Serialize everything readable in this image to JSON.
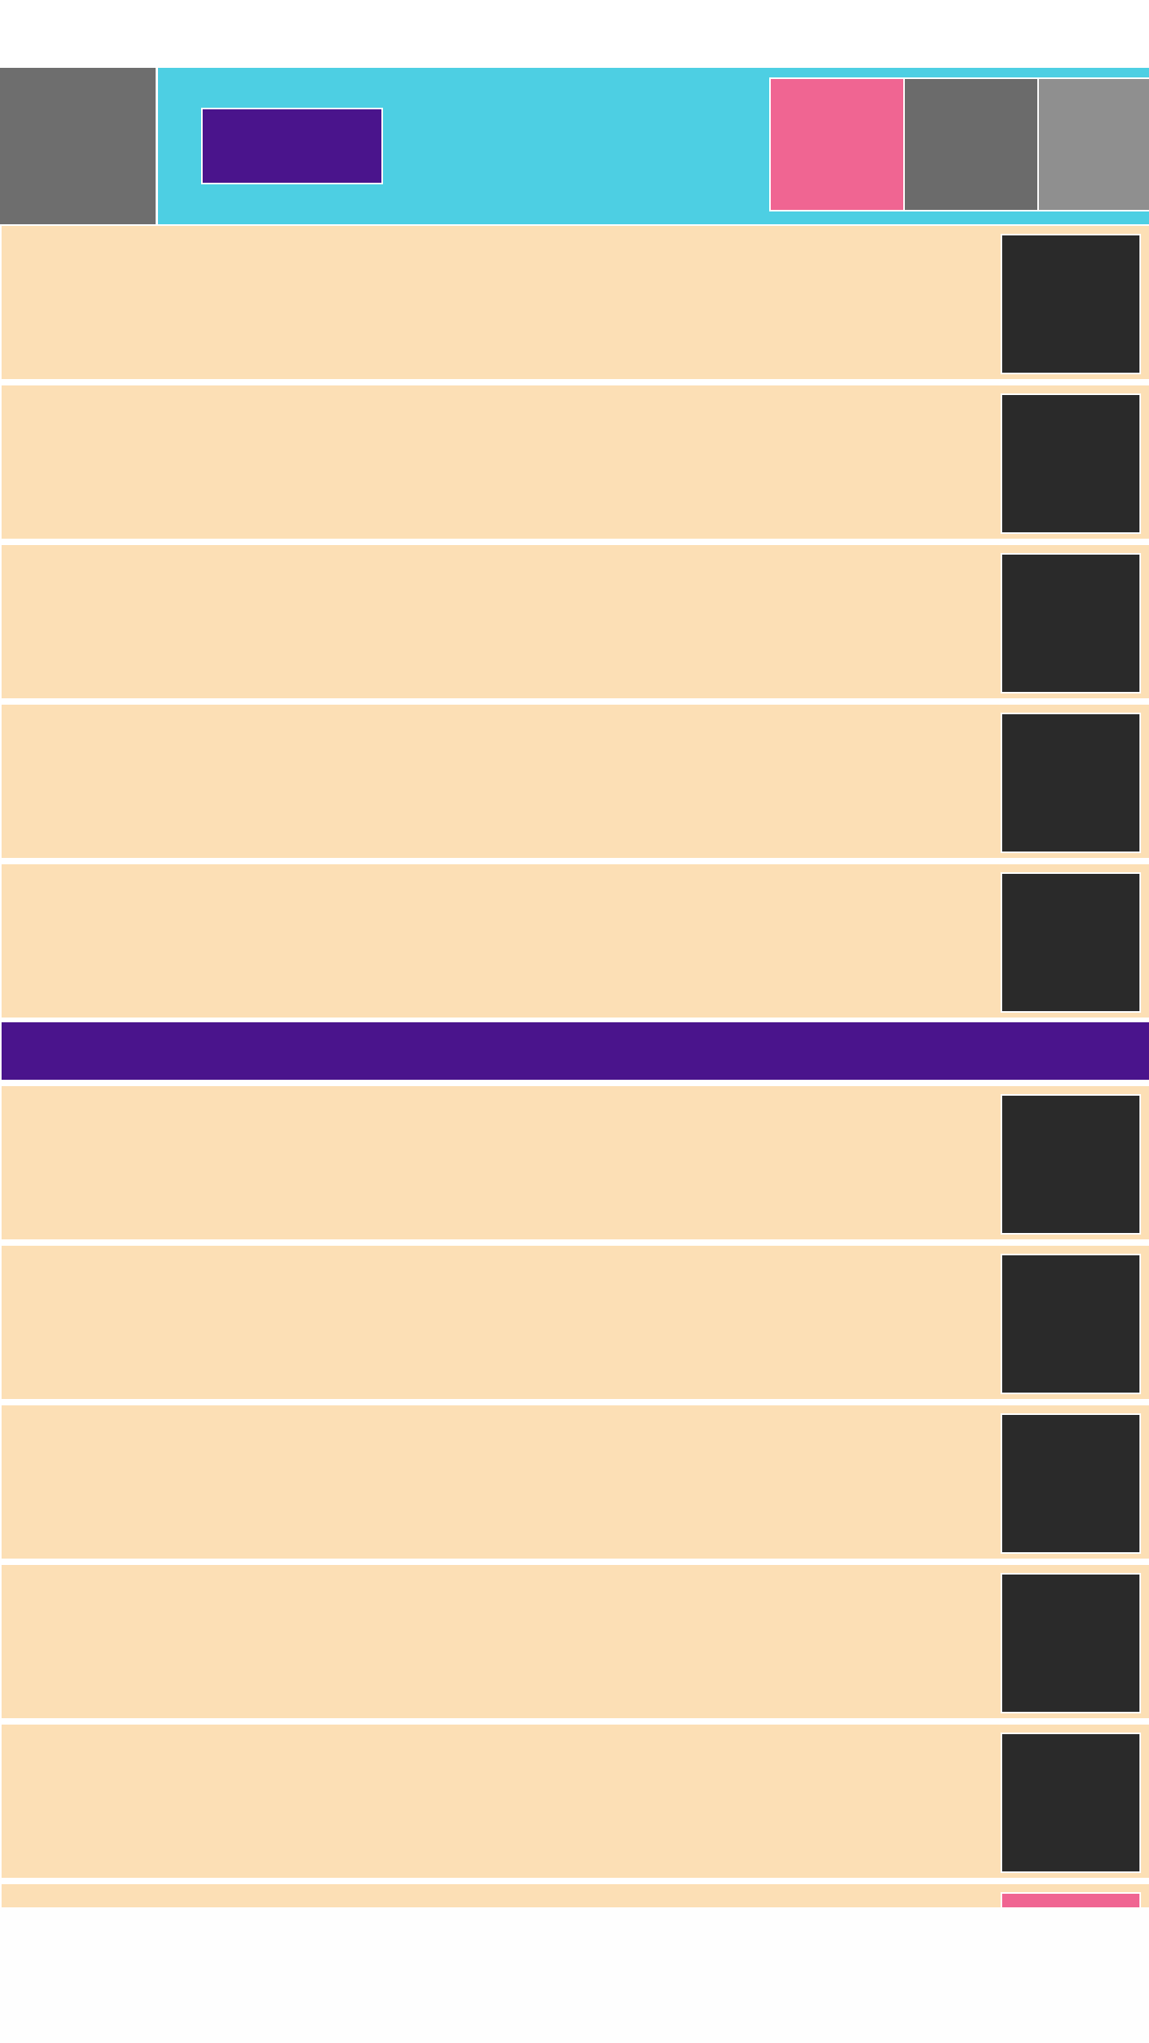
{
  "colors": {
    "header_bg": "#4dcfe3",
    "logo_bg": "#6e6e6e",
    "primary_bg": "#4a148c",
    "pink": "#f06592",
    "gray_dark": "#6b6b6b",
    "gray_light": "#8f8f8f",
    "row_bg": "#fcdfb5",
    "thumb_bg": "#2a2a2a",
    "section_bg": "#4a148c"
  },
  "header": {
    "logo": {
      "icon": "logo-placeholder",
      "label": ""
    },
    "primary_button": {
      "label": ""
    },
    "actions": [
      {
        "label": "",
        "color": "#f06592"
      },
      {
        "label": "",
        "color": "#6b6b6b"
      },
      {
        "label": "",
        "color": "#8f8f8f"
      }
    ]
  },
  "section_divider": {
    "label": ""
  },
  "list_items": [
    {
      "title": "",
      "thumb_icon": "image-placeholder"
    },
    {
      "title": "",
      "thumb_icon": "image-placeholder"
    },
    {
      "title": "",
      "thumb_icon": "image-placeholder"
    },
    {
      "title": "",
      "thumb_icon": "image-placeholder"
    },
    {
      "title": "",
      "thumb_icon": "image-placeholder"
    }
  ],
  "list_items_2": [
    {
      "title": "",
      "thumb_icon": "image-placeholder"
    },
    {
      "title": "",
      "thumb_icon": "image-placeholder"
    },
    {
      "title": "",
      "thumb_icon": "image-placeholder"
    },
    {
      "title": "",
      "thumb_icon": "image-placeholder"
    },
    {
      "title": "",
      "thumb_icon": "image-placeholder"
    },
    {
      "title": "",
      "thumb_icon": "image-placeholder-accent"
    }
  ]
}
